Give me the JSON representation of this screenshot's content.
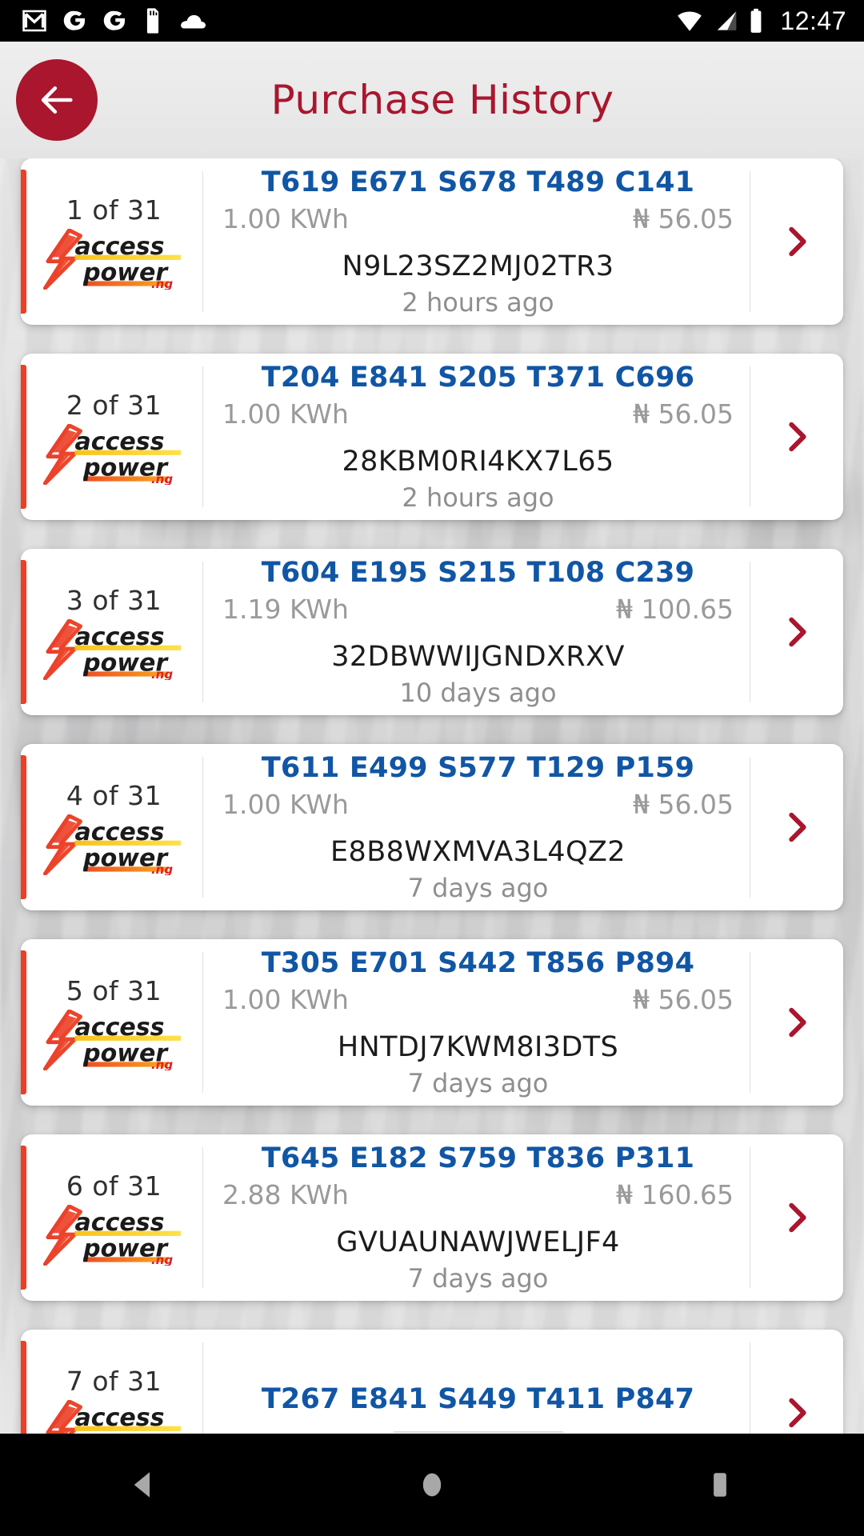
{
  "status_bar": {
    "clock": "12:47",
    "left_icons": [
      "gmail-icon",
      "google-icon",
      "google-icon",
      "sd-card-icon",
      "cloud-icon"
    ],
    "right_icons": [
      "wifi-icon",
      "cellular-signal-icon",
      "battery-icon"
    ]
  },
  "header": {
    "title": "Purchase History",
    "back_icon": "arrow-left-icon",
    "accent_color": "#a9162e"
  },
  "theme": {
    "accent_red": "#a9162e",
    "card_accent": "#ef3e23",
    "meter_blue": "#1156a5",
    "muted_gray": "#9a9a9a",
    "logo_brand": "access power",
    "logo_tld": ".ng"
  },
  "list": {
    "total": 31,
    "chevron_icon": "chevron-right-icon",
    "items": [
      {
        "index_label": "1 of 31",
        "meter": "T619 E671 S678 T489 C141",
        "kwh": "1.00 KWh",
        "amount": "₦ 56.05",
        "token": "N9L23SZ2MJ02TR3",
        "ago": "2 hours ago"
      },
      {
        "index_label": "2 of 31",
        "meter": "T204 E841 S205 T371 C696",
        "kwh": "1.00 KWh",
        "amount": "₦ 56.05",
        "token": "28KBM0RI4KX7L65",
        "ago": "2 hours ago"
      },
      {
        "index_label": "3 of 31",
        "meter": "T604 E195 S215 T108 C239",
        "kwh": "1.19 KWh",
        "amount": "₦ 100.65",
        "token": "32DBWWIJGNDXRXV",
        "ago": "10 days ago"
      },
      {
        "index_label": "4 of 31",
        "meter": "T611 E499 S577 T129 P159",
        "kwh": "1.00 KWh",
        "amount": "₦ 56.05",
        "token": "E8B8WXMVA3L4QZ2",
        "ago": "7 days ago"
      },
      {
        "index_label": "5 of 31",
        "meter": "T305 E701 S442 T856 P894",
        "kwh": "1.00 KWh",
        "amount": "₦ 56.05",
        "token": "HNTDJ7KWM8I3DTS",
        "ago": "7 days ago"
      },
      {
        "index_label": "6 of 31",
        "meter": "T645 E182 S759 T836 P311",
        "kwh": "2.88 KWh",
        "amount": "₦ 160.65",
        "token": "GVUAUNAWJWELJF4",
        "ago": "7 days ago"
      },
      {
        "index_label": "7 of 31",
        "meter": "T267 E841 S449 T411 P847",
        "kwh": "",
        "amount": "",
        "token": "",
        "ago": ""
      }
    ]
  },
  "nav_bar": {
    "buttons": [
      {
        "name": "back-nav-button",
        "icon": "triangle-back-icon"
      },
      {
        "name": "home-nav-button",
        "icon": "circle-home-icon"
      },
      {
        "name": "recents-nav-button",
        "icon": "square-recents-icon"
      }
    ]
  }
}
